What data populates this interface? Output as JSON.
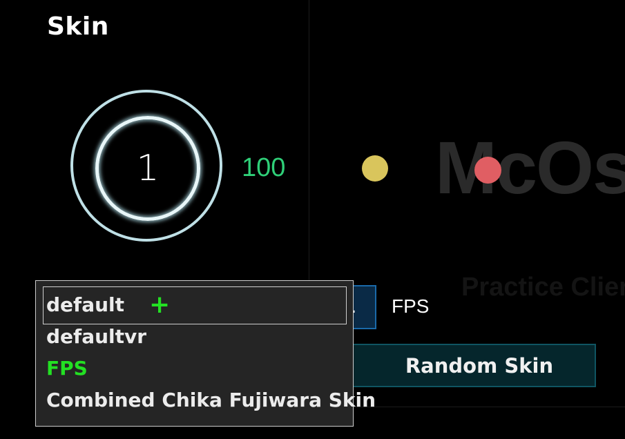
{
  "panel": {
    "title": "Skin"
  },
  "preview": {
    "combo_number": "1",
    "accuracy": "100"
  },
  "background": {
    "logo_text": "McOs",
    "subtitle": "Practice Clier"
  },
  "controls": {
    "skin_button_label": ".",
    "fps_label": "FPS",
    "random_skin_label": "Random Skin"
  },
  "dropdown": {
    "items": [
      {
        "label": "default",
        "selected": true
      },
      {
        "label": "defaultvr"
      },
      {
        "label": "FPS",
        "color": "#23e023"
      },
      {
        "label": "Combined Chika Fujiwara Skin"
      }
    ]
  },
  "colors": {
    "accent_green": "#2fcf78",
    "fps_item_green": "#23e023",
    "button_blue": "#1a6aaa",
    "button_teal": "#0f5562"
  }
}
